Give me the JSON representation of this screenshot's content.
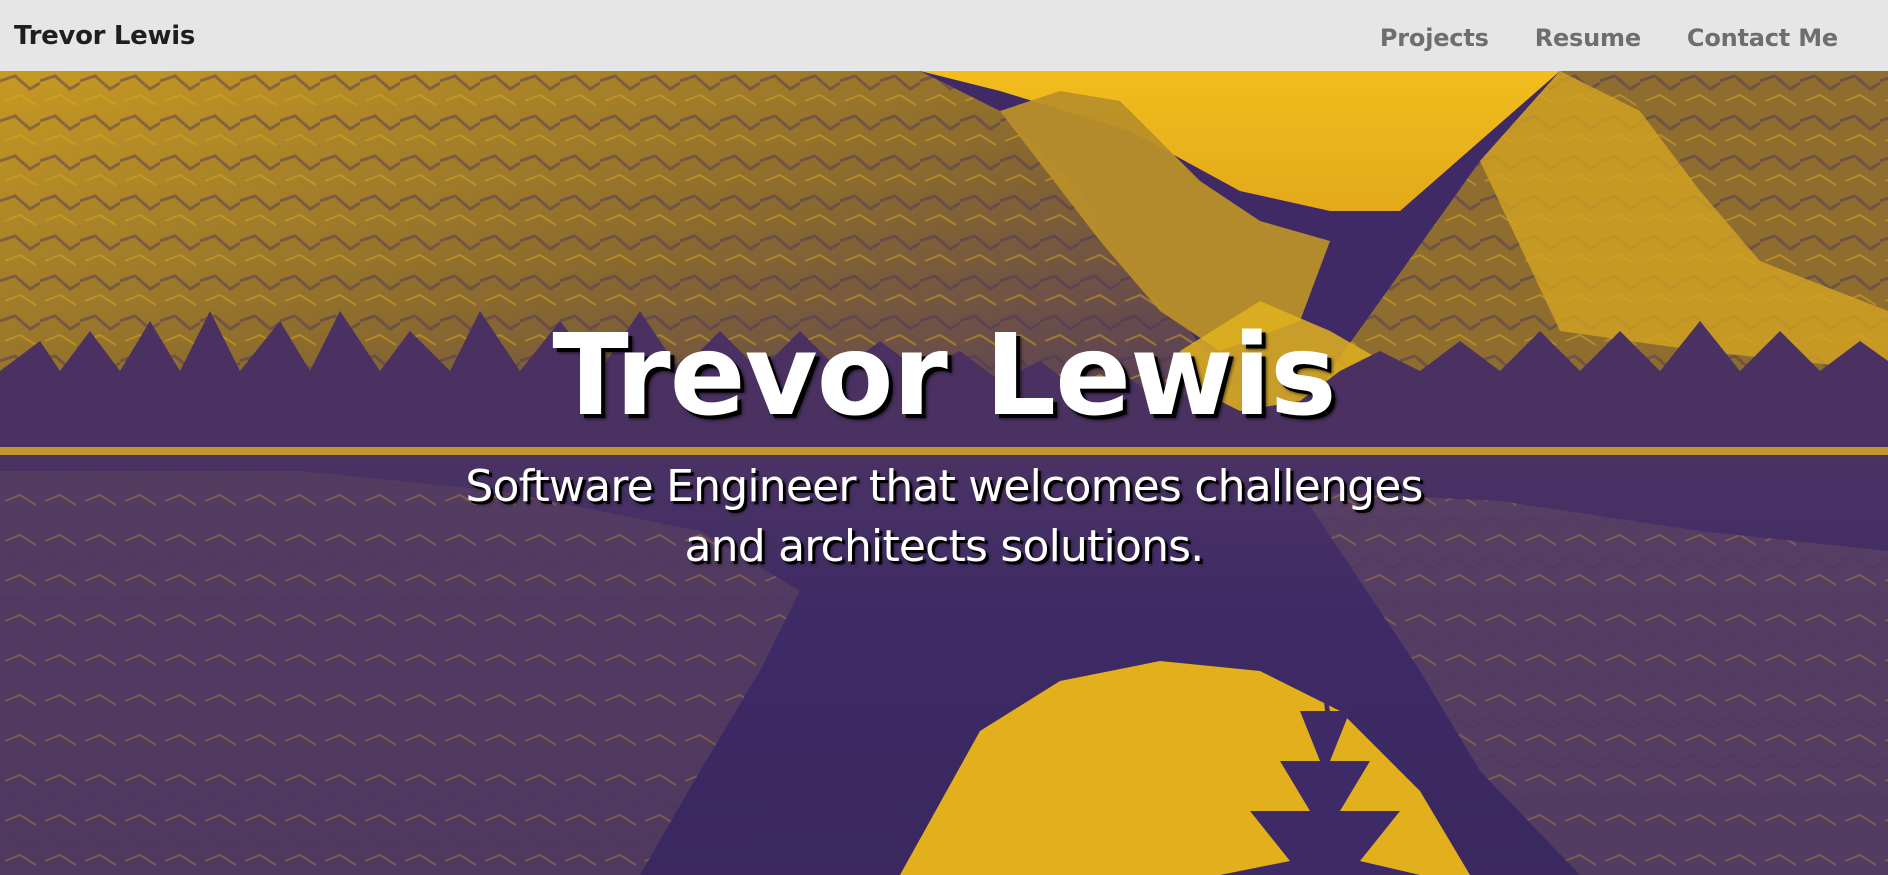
{
  "nav": {
    "brand": "Trevor Lewis",
    "links": [
      "Projects",
      "Resume",
      "Contact Me"
    ]
  },
  "hero": {
    "title": "Trevor Lewis",
    "subtitle_line1": "Software Engineer that welcomes challenges",
    "subtitle_line2": "and architects solutions."
  },
  "colors": {
    "navbar_bg": "#e6e6e6",
    "brand_text": "#1e1e1e",
    "nav_link": "#6e6e6e",
    "duotone_dark": "#3f2a66",
    "duotone_light": "#f2bd1d",
    "hero_text": "#ffffff"
  }
}
